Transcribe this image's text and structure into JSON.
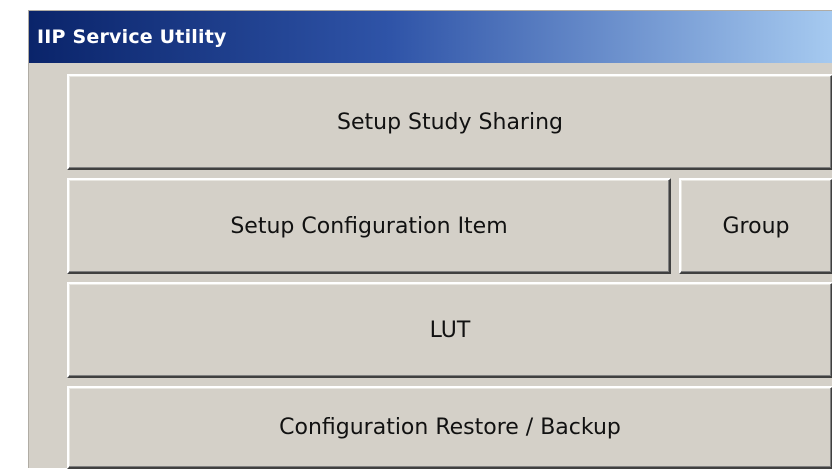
{
  "window": {
    "title": "IIP Service Utility"
  },
  "buttons": {
    "setup_study_sharing": "Setup Study Sharing",
    "setup_configuration_item": "Setup Configuration Item",
    "group": "Group",
    "lut": "LUT",
    "configuration_restore_backup": "Configuration Restore / Backup"
  },
  "colors": {
    "titlebar_start": "#0a246a",
    "titlebar_end": "#a6caf0",
    "window_background": "#d4d0c8",
    "button_text": "#111111"
  }
}
